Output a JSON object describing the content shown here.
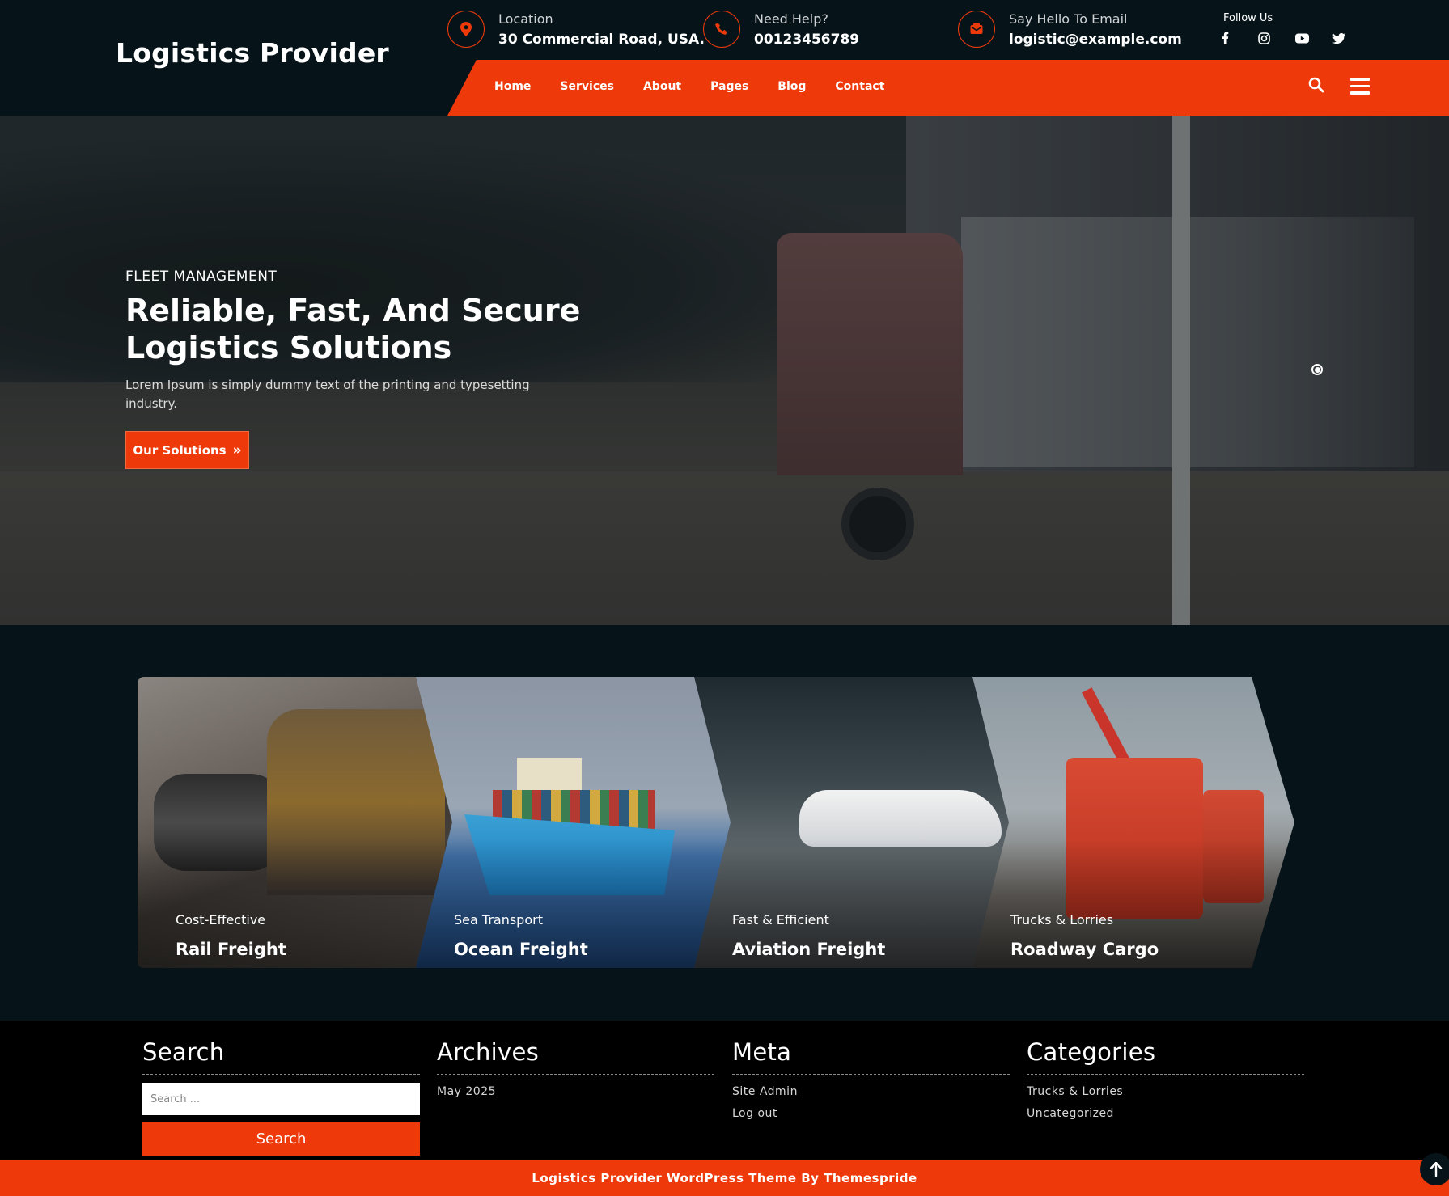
{
  "brand": {
    "name": "Logistics Provider",
    "accent": "#ee3a0a",
    "background": "#06141a"
  },
  "contact": {
    "location_label": "Location",
    "location_value": "30 Commercial Road, USA.",
    "help_label": "Need Help?",
    "help_value": "00123456789",
    "email_label": "Say Hello To Email",
    "email_value": "logistic@example.com",
    "location_icon": "map-pin-icon",
    "phone_icon": "phone-icon",
    "email_icon": "envelope-icon"
  },
  "social": {
    "label": "Follow Us",
    "items": [
      {
        "icon": "facebook-icon",
        "glyph": "f"
      },
      {
        "icon": "instagram-icon",
        "glyph": "◎"
      },
      {
        "icon": "youtube-icon",
        "glyph": "▶"
      },
      {
        "icon": "twitter-icon",
        "glyph": "🐦"
      }
    ]
  },
  "nav": {
    "items": [
      "Home",
      "Services",
      "About",
      "Pages",
      "Blog",
      "Contact"
    ]
  },
  "hero": {
    "subtitle": "FLEET MANAGEMENT",
    "title": "Reliable, Fast, And Secure Logistics Solutions",
    "text": "Lorem Ipsum is simply dummy text of the printing and typesetting industry.",
    "cta": "Our Solutions",
    "cta_icon": "»"
  },
  "services": [
    {
      "category": "Cost-Effective",
      "name": "Rail Freight"
    },
    {
      "category": "Sea Transport",
      "name": "Ocean Freight"
    },
    {
      "category": "Fast & Efficient",
      "name": "Aviation Freight"
    },
    {
      "category": "Trucks & Lorries",
      "name": "Roadway Cargo"
    }
  ],
  "widgets": {
    "search": {
      "title": "Search",
      "placeholder": "Search ...",
      "button": "Search"
    },
    "archives": {
      "title": "Archives",
      "items": [
        "May 2025"
      ]
    },
    "meta": {
      "title": "Meta",
      "items": [
        "Site Admin",
        "Log out"
      ]
    },
    "categories": {
      "title": "Categories",
      "items": [
        "Trucks & Lorries",
        "Uncategorized"
      ]
    }
  },
  "footer": {
    "copyright": "Logistics Provider WordPress Theme By Themespride"
  }
}
